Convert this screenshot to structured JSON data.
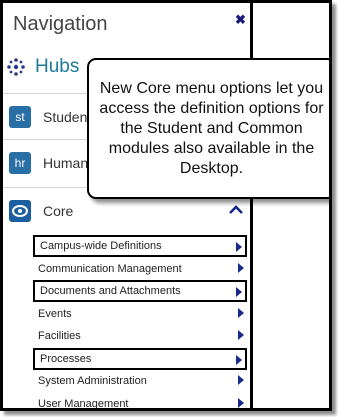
{
  "panel": {
    "title": "Navigation",
    "close_glyph": "✖"
  },
  "hubs": {
    "label": "Hubs",
    "icon": "hub-dots-icon"
  },
  "nav_items": [
    {
      "icon_text": "st",
      "label": "Student",
      "color": "#2a6ea6"
    },
    {
      "icon_text": "hr",
      "label": "Human",
      "color": "#2a6ea6"
    },
    {
      "icon_text": "",
      "label": "Core",
      "color": "#1c5fa0"
    }
  ],
  "core_submenu": [
    {
      "label": "Campus-wide Definitions",
      "highlighted": true
    },
    {
      "label": "Communication Management",
      "highlighted": false
    },
    {
      "label": "Documents and Attachments",
      "highlighted": true
    },
    {
      "label": "Events",
      "highlighted": false
    },
    {
      "label": "Facilities",
      "highlighted": false
    },
    {
      "label": "Processes",
      "highlighted": true
    },
    {
      "label": "System Administration",
      "highlighted": false
    },
    {
      "label": "User Management",
      "highlighted": false
    }
  ],
  "callout": {
    "text": "New Core menu options let you access the definition options for the Student and Common modules also available in the Desktop."
  },
  "colors": {
    "accent": "#1a2a8a",
    "hubs_text": "#1e7a9a",
    "border": "#000000"
  }
}
